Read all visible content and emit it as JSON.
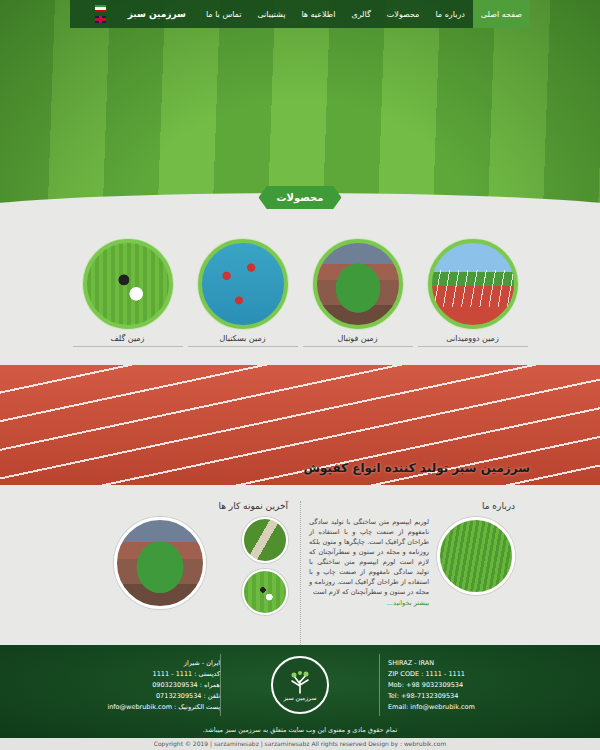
{
  "nav": {
    "items": [
      {
        "label": "صفحه اصلی",
        "selected": true
      },
      {
        "label": "درباره ما",
        "selected": false
      },
      {
        "label": "محصولات",
        "selected": false
      },
      {
        "label": "گالری",
        "selected": false
      },
      {
        "label": "اطلاعیه ها",
        "selected": false
      },
      {
        "label": "پشتیبانی",
        "selected": false
      },
      {
        "label": "تماس با ما",
        "selected": false
      }
    ],
    "logo": "سرزمین سبز"
  },
  "languages": [
    {
      "kind": "iran"
    },
    {
      "kind": "uk"
    }
  ],
  "products": {
    "title": "محصولات",
    "items": [
      {
        "label": "زمین دوومیدانی",
        "kind": "track"
      },
      {
        "label": "زمین فوتبال",
        "kind": "football"
      },
      {
        "label": "زمین بسکتبال",
        "kind": "basketball"
      },
      {
        "label": "زمین گلف",
        "kind": "golf"
      }
    ]
  },
  "banner": {
    "text": "سرزمین سبز تولید کننده انواع کفپوش"
  },
  "about": {
    "title": "درباره ما",
    "text": "لوریم ایپسوم متن ساختگی با تولید سادگی نامفهوم از صنعت چاپ و با استفاده از طراحان گرافیک است. چاپگرها و متون بلکه روزنامه و مجله در ستون و سطرآنچنان که لازم است لورم ایپسوم متن ساختگی با تولید سادگی نامفهوم از صنعت چاپ و با استفاده از طراحان گرافیک است. روزنامه و مجله در ستون و سطرآنچنان که لازم است",
    "more": "بیشتر بخوانید..."
  },
  "portfolio": {
    "title": "آخرین نمونه کار ها",
    "items": [
      {
        "kind": "path"
      },
      {
        "kind": "golf"
      },
      {
        "kind": "football"
      }
    ]
  },
  "footer": {
    "fa": [
      "ایران - شیراز",
      "کدپستی : 1111 - 1111",
      "همراه : 09032309534",
      "تلفن : 07132309534",
      "پست الکترونیک : info@webrubik.com"
    ],
    "en": [
      "SHIRAZ - IRAN",
      "ZIP CODE : 1111 - 1111",
      "Mob: +98 9032309534",
      "Tel: +98-7132309534",
      "Email: info@webrubik.com"
    ],
    "logo": "سرزمین سبز",
    "rights": "تمام حقوق مادی و معنوی این وب سایت متعلق به سرزمین سبز میباشد.",
    "copyright": "Copyright © 2019 | sarzaminesabz | sarzaminesabz All rights reserved Design by : webrubik.com"
  }
}
